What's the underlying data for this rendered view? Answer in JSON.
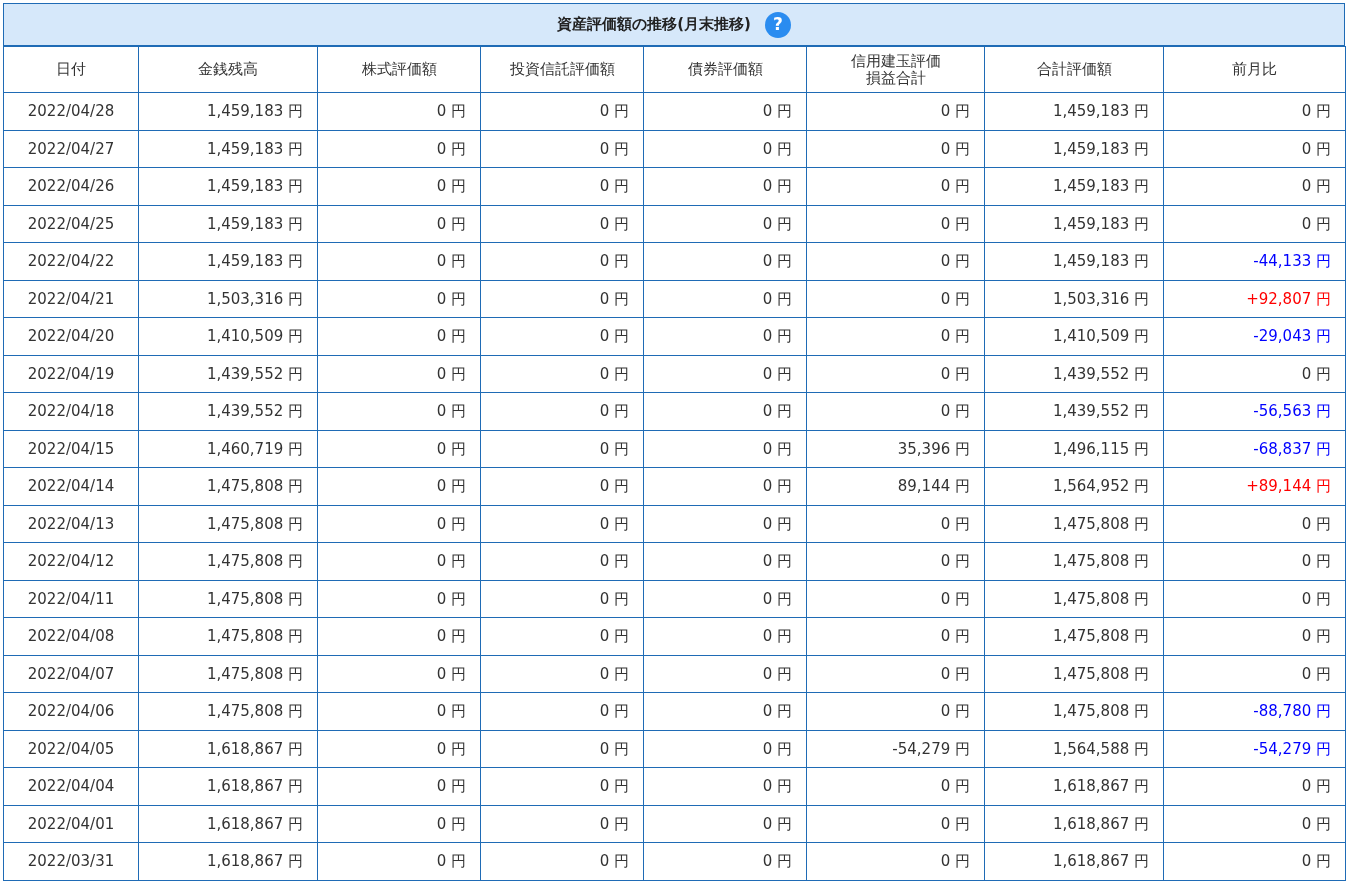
{
  "title": "資産評価額の推移(月末推移)",
  "help": "?",
  "columns": [
    "日付",
    "金銭残高",
    "株式評価額",
    "投資信託評価額",
    "債券評価額",
    "信用建玉評価損益合計",
    "合計評価額",
    "前月比"
  ],
  "rows": [
    {
      "cells": [
        "2022/04/28",
        "1,459,183 円",
        "0 円",
        "0 円",
        "0 円",
        "0 円",
        "1,459,183 円"
      ],
      "change": {
        "text": "0 円",
        "color": "#333333"
      }
    },
    {
      "cells": [
        "2022/04/27",
        "1,459,183 円",
        "0 円",
        "0 円",
        "0 円",
        "0 円",
        "1,459,183 円"
      ],
      "change": {
        "text": "0 円",
        "color": "#333333"
      }
    },
    {
      "cells": [
        "2022/04/26",
        "1,459,183 円",
        "0 円",
        "0 円",
        "0 円",
        "0 円",
        "1,459,183 円"
      ],
      "change": {
        "text": "0 円",
        "color": "#333333"
      }
    },
    {
      "cells": [
        "2022/04/25",
        "1,459,183 円",
        "0 円",
        "0 円",
        "0 円",
        "0 円",
        "1,459,183 円"
      ],
      "change": {
        "text": "0 円",
        "color": "#333333"
      }
    },
    {
      "cells": [
        "2022/04/22",
        "1,459,183 円",
        "0 円",
        "0 円",
        "0 円",
        "0 円",
        "1,459,183 円"
      ],
      "change": {
        "text": "-44,133 円",
        "color": "#0000ff"
      }
    },
    {
      "cells": [
        "2022/04/21",
        "1,503,316 円",
        "0 円",
        "0 円",
        "0 円",
        "0 円",
        "1,503,316 円"
      ],
      "change": {
        "text": "+92,807 円",
        "color": "#ff0000"
      }
    },
    {
      "cells": [
        "2022/04/20",
        "1,410,509 円",
        "0 円",
        "0 円",
        "0 円",
        "0 円",
        "1,410,509 円"
      ],
      "change": {
        "text": "-29,043 円",
        "color": "#0000ff"
      }
    },
    {
      "cells": [
        "2022/04/19",
        "1,439,552 円",
        "0 円",
        "0 円",
        "0 円",
        "0 円",
        "1,439,552 円"
      ],
      "change": {
        "text": "0 円",
        "color": "#333333"
      }
    },
    {
      "cells": [
        "2022/04/18",
        "1,439,552 円",
        "0 円",
        "0 円",
        "0 円",
        "0 円",
        "1,439,552 円"
      ],
      "change": {
        "text": "-56,563 円",
        "color": "#0000ff"
      }
    },
    {
      "cells": [
        "2022/04/15",
        "1,460,719 円",
        "0 円",
        "0 円",
        "0 円",
        "35,396 円",
        "1,496,115 円"
      ],
      "change": {
        "text": "-68,837 円",
        "color": "#0000ff"
      }
    },
    {
      "cells": [
        "2022/04/14",
        "1,475,808 円",
        "0 円",
        "0 円",
        "0 円",
        "89,144 円",
        "1,564,952 円"
      ],
      "change": {
        "text": "+89,144 円",
        "color": "#ff0000"
      }
    },
    {
      "cells": [
        "2022/04/13",
        "1,475,808 円",
        "0 円",
        "0 円",
        "0 円",
        "0 円",
        "1,475,808 円"
      ],
      "change": {
        "text": "0 円",
        "color": "#333333"
      }
    },
    {
      "cells": [
        "2022/04/12",
        "1,475,808 円",
        "0 円",
        "0 円",
        "0 円",
        "0 円",
        "1,475,808 円"
      ],
      "change": {
        "text": "0 円",
        "color": "#333333"
      }
    },
    {
      "cells": [
        "2022/04/11",
        "1,475,808 円",
        "0 円",
        "0 円",
        "0 円",
        "0 円",
        "1,475,808 円"
      ],
      "change": {
        "text": "0 円",
        "color": "#333333"
      }
    },
    {
      "cells": [
        "2022/04/08",
        "1,475,808 円",
        "0 円",
        "0 円",
        "0 円",
        "0 円",
        "1,475,808 円"
      ],
      "change": {
        "text": "0 円",
        "color": "#333333"
      }
    },
    {
      "cells": [
        "2022/04/07",
        "1,475,808 円",
        "0 円",
        "0 円",
        "0 円",
        "0 円",
        "1,475,808 円"
      ],
      "change": {
        "text": "0 円",
        "color": "#333333"
      }
    },
    {
      "cells": [
        "2022/04/06",
        "1,475,808 円",
        "0 円",
        "0 円",
        "0 円",
        "0 円",
        "1,475,808 円"
      ],
      "change": {
        "text": "-88,780 円",
        "color": "#0000ff"
      }
    },
    {
      "cells": [
        "2022/04/05",
        "1,618,867 円",
        "0 円",
        "0 円",
        "0 円",
        "-54,279 円",
        "1,564,588 円"
      ],
      "change": {
        "text": "-54,279 円",
        "color": "#0000ff"
      }
    },
    {
      "cells": [
        "2022/04/04",
        "1,618,867 円",
        "0 円",
        "0 円",
        "0 円",
        "0 円",
        "1,618,867 円"
      ],
      "change": {
        "text": "0 円",
        "color": "#333333"
      }
    },
    {
      "cells": [
        "2022/04/01",
        "1,618,867 円",
        "0 円",
        "0 円",
        "0 円",
        "0 円",
        "1,618,867 円"
      ],
      "change": {
        "text": "0 円",
        "color": "#333333"
      }
    },
    {
      "cells": [
        "2022/03/31",
        "1,618,867 円",
        "0 円",
        "0 円",
        "0 円",
        "0 円",
        "1,618,867 円"
      ],
      "change": {
        "text": "0 円",
        "color": "#333333"
      }
    }
  ]
}
